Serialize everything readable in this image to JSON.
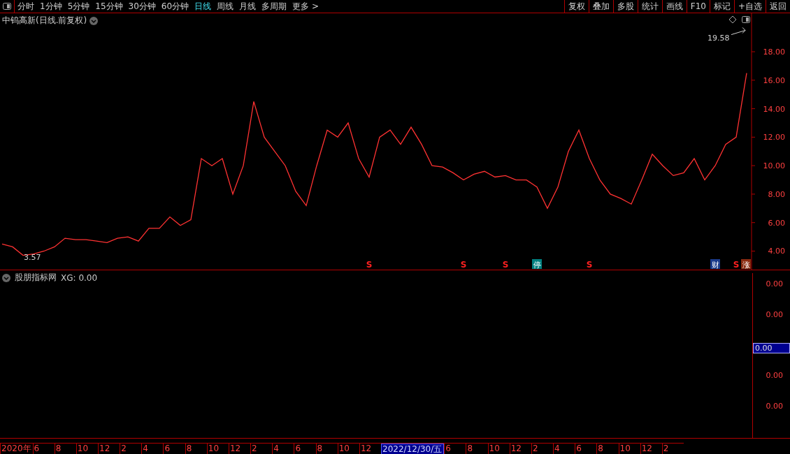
{
  "toolbar": {
    "periods": [
      {
        "label": "分时",
        "selected": false
      },
      {
        "label": "1分钟",
        "selected": false
      },
      {
        "label": "5分钟",
        "selected": false
      },
      {
        "label": "15分钟",
        "selected": false
      },
      {
        "label": "30分钟",
        "selected": false
      },
      {
        "label": "60分钟",
        "selected": false
      },
      {
        "label": "日线",
        "selected": true
      },
      {
        "label": "周线",
        "selected": false
      },
      {
        "label": "月线",
        "selected": false
      },
      {
        "label": "多周期",
        "selected": false
      },
      {
        "label": "更多 >",
        "selected": false
      }
    ],
    "buttons": [
      "复权",
      "叠加",
      "多股",
      "统计",
      "画线",
      "F10",
      "标记",
      "+自选",
      "返回"
    ]
  },
  "price_panel": {
    "title": "中钨高新(日线.前复权)",
    "high_label": "19.58",
    "low_label": "3.57",
    "chart_data": {
      "type": "line",
      "ylim": [
        2.7,
        20.7
      ],
      "yticks": [
        {
          "value": 4,
          "label": "4.00"
        },
        {
          "value": 6,
          "label": "6.00"
        },
        {
          "value": 8,
          "label": "8.00"
        },
        {
          "value": 10,
          "label": "10.00"
        },
        {
          "value": 12,
          "label": "12.00"
        },
        {
          "value": 14,
          "label": "14.00"
        },
        {
          "value": 16,
          "label": "16.00"
        },
        {
          "value": 18,
          "label": "18.00"
        }
      ],
      "series": [
        {
          "color": "#ff3232",
          "values": [
            4.5,
            4.3,
            3.7,
            3.8,
            4.0,
            4.3,
            4.9,
            4.8,
            4.8,
            4.7,
            4.6,
            4.9,
            5.0,
            4.7,
            5.6,
            5.6,
            6.4,
            5.8,
            6.2,
            10.5,
            10.0,
            10.5,
            8.0,
            10.0,
            14.5,
            12.0,
            11.0,
            10.0,
            8.2,
            7.2,
            10.0,
            12.5,
            12.0,
            13.0,
            10.5,
            9.2,
            12.0,
            12.5,
            11.5,
            12.7,
            11.5,
            10.0,
            9.9,
            9.5,
            9.0,
            9.4,
            9.6,
            9.2,
            9.3,
            9.0,
            9.0,
            8.5,
            7.0,
            8.5,
            11.0,
            12.5,
            10.5,
            9.0,
            8.0,
            7.7,
            7.3,
            9.0,
            10.8,
            10.0,
            9.3,
            9.5,
            10.5,
            9.0,
            10.0,
            11.5,
            12.0,
            16.5
          ]
        }
      ]
    },
    "markers": [
      {
        "kind": "signal",
        "text": "S"
      },
      {
        "kind": "signal",
        "text": "S"
      },
      {
        "kind": "signal",
        "text": "S"
      },
      {
        "kind": "tag",
        "text": "停",
        "color": "#008080"
      },
      {
        "kind": "signal",
        "text": "S"
      },
      {
        "kind": "tag",
        "text": "财",
        "color": "#1a3a8a"
      },
      {
        "kind": "signal",
        "text": "S"
      },
      {
        "kind": "tag",
        "text": "涨",
        "color": "#8a2a10"
      }
    ]
  },
  "indicator_panel": {
    "title": "股朋指标网",
    "reading": "XG: 0.00",
    "ticks": [
      "0.00",
      "0.00",
      "0.00",
      "0.00"
    ],
    "current": "0.00"
  },
  "time_axis": [
    {
      "label": "2020年",
      "selected": false
    },
    {
      "label": "6",
      "selected": false
    },
    {
      "label": "8",
      "selected": false
    },
    {
      "label": "10",
      "selected": false
    },
    {
      "label": "12",
      "selected": false
    },
    {
      "label": "2",
      "selected": false
    },
    {
      "label": "4",
      "selected": false
    },
    {
      "label": "6",
      "selected": false
    },
    {
      "label": "8",
      "selected": false
    },
    {
      "label": "10",
      "selected": false
    },
    {
      "label": "12",
      "selected": false
    },
    {
      "label": "2",
      "selected": false
    },
    {
      "label": "4",
      "selected": false
    },
    {
      "label": "6",
      "selected": false
    },
    {
      "label": "8",
      "selected": false
    },
    {
      "label": "10",
      "selected": false
    },
    {
      "label": "12",
      "selected": false
    },
    {
      "label": "2022/12/30/五",
      "selected": true
    },
    {
      "label": "6",
      "selected": false
    },
    {
      "label": "8",
      "selected": false
    },
    {
      "label": "10",
      "selected": false
    },
    {
      "label": "12",
      "selected": false
    },
    {
      "label": "2",
      "selected": false
    },
    {
      "label": "4",
      "selected": false
    },
    {
      "label": "6",
      "selected": false
    },
    {
      "label": "8",
      "selected": false
    },
    {
      "label": "10",
      "selected": false
    },
    {
      "label": "12",
      "selected": false
    },
    {
      "label": "2",
      "selected": false
    }
  ]
}
